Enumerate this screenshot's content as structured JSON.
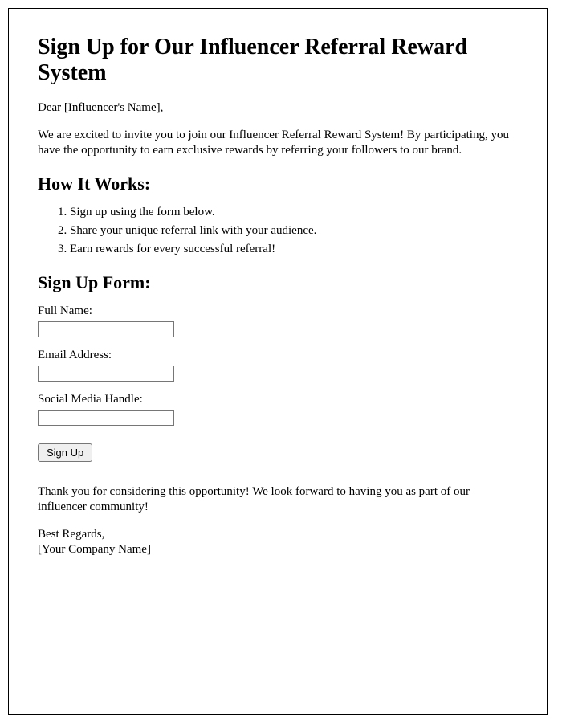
{
  "title": "Sign Up for Our Influencer Referral Reward System",
  "greeting": "Dear [Influencer's Name],",
  "intro": "We are excited to invite you to join our Influencer Referral Reward System! By participating, you have the opportunity to earn exclusive rewards by referring your followers to our brand.",
  "howItWorks": {
    "heading": "How It Works:",
    "steps": [
      "Sign up using the form below.",
      "Share your unique referral link with your audience.",
      "Earn rewards for every successful referral!"
    ]
  },
  "form": {
    "heading": "Sign Up Form:",
    "fields": {
      "fullName": {
        "label": "Full Name:",
        "value": ""
      },
      "email": {
        "label": "Email Address:",
        "value": ""
      },
      "social": {
        "label": "Social Media Handle:",
        "value": ""
      }
    },
    "submitLabel": "Sign Up"
  },
  "thankYou": "Thank you for considering this opportunity! We look forward to having you as part of our influencer community!",
  "closing": {
    "regards": "Best Regards,",
    "company": "[Your Company Name]"
  }
}
